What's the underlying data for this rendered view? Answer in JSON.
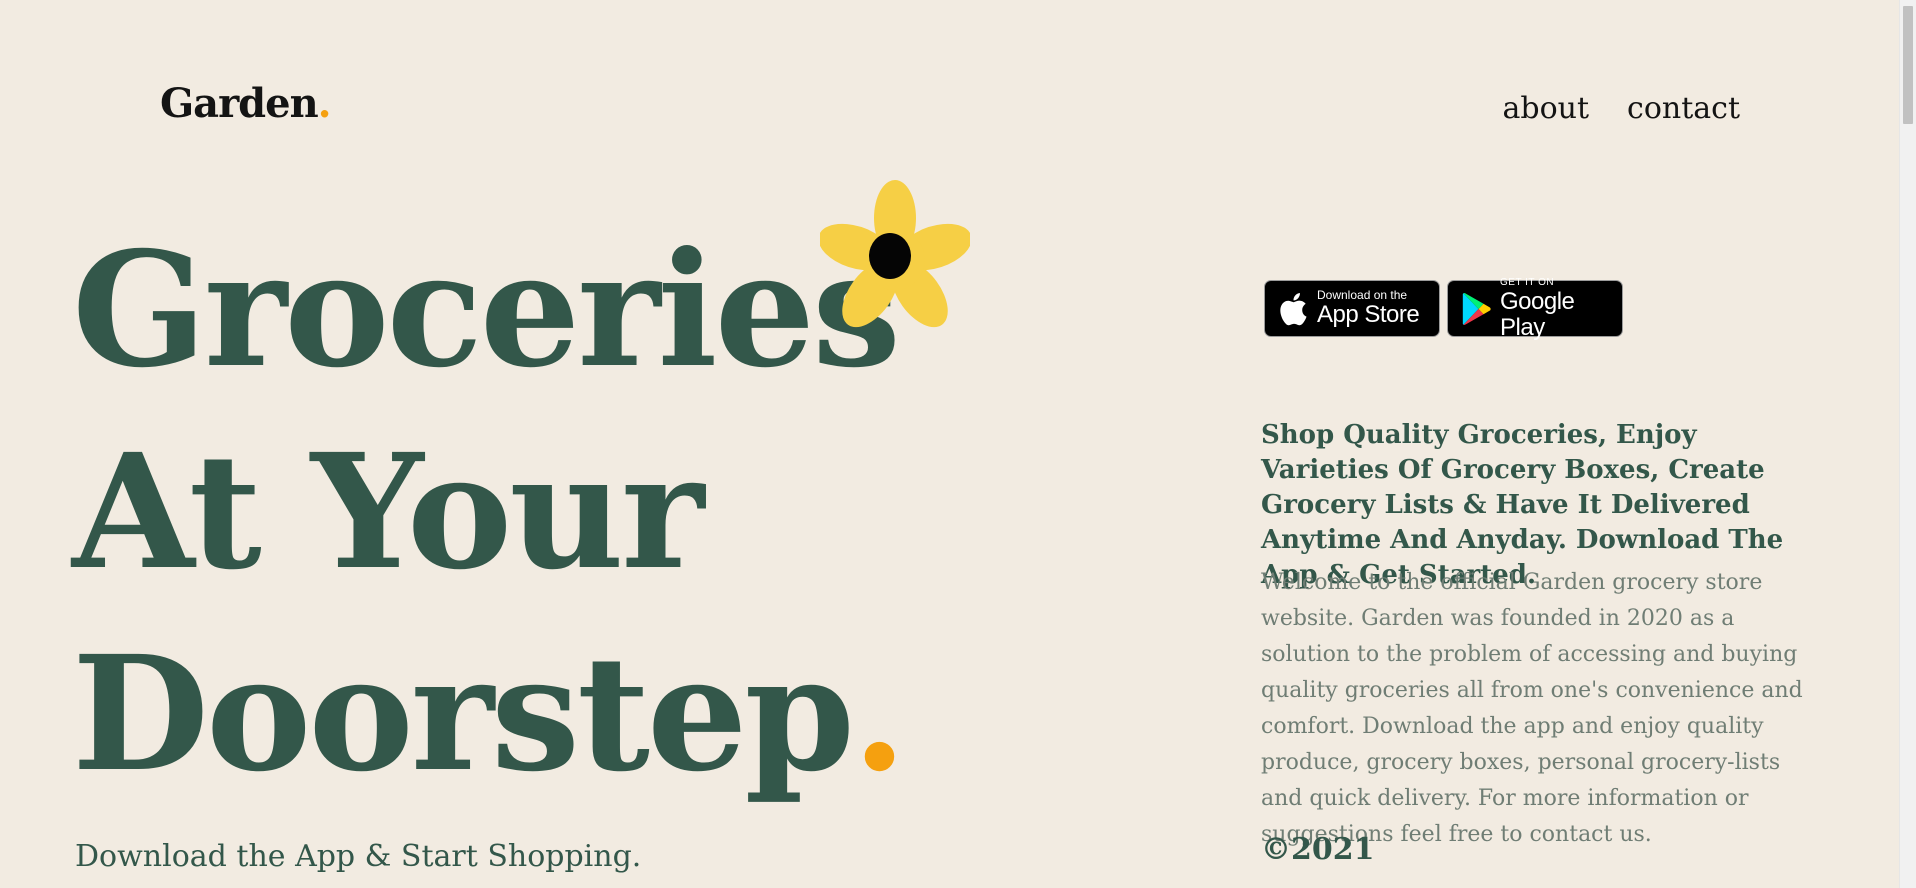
{
  "brand": {
    "name": "Garden",
    "dot": ".",
    "accent_color": "#f5a00f"
  },
  "nav": {
    "items": [
      "about",
      "contact"
    ]
  },
  "hero": {
    "lines": [
      "Groceries",
      "At Your",
      "Doorstep"
    ],
    "dot": ".",
    "flower_icon": "flower-icon",
    "tagline": "Download the App & Start Shopping."
  },
  "stores": {
    "app_store": {
      "small": "Download on the",
      "big": "App Store",
      "icon": "apple-icon"
    },
    "google_play": {
      "small": "GET IT ON",
      "big": "Google Play",
      "icon": "play-icon"
    }
  },
  "content": {
    "lead": "Shop Quality Groceries, Enjoy Varieties Of Grocery Boxes, Create Grocery Lists & Have It Delivered Anytime And Anyday. Download The App & Get Started.",
    "body": "Welcome to the official Garden grocery store website. Garden was founded in 2020 as a solution to the problem of accessing and buying quality groceries all from one's convenience and comfort. Download the app and enjoy quality produce, grocery boxes, personal grocery-lists and quick delivery. For more information or suggestions feel free to contact us.",
    "copyright": "©2021"
  },
  "colors": {
    "background": "#f2ebe1",
    "primary_green": "#33574a",
    "flower_yellow": "#f6cf45",
    "text_muted": "#6f7d74"
  }
}
